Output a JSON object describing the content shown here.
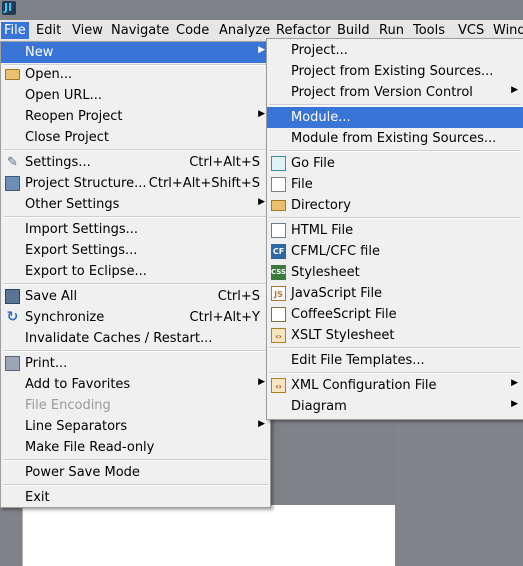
{
  "menubar": {
    "items": [
      "File",
      "Edit",
      "View",
      "Navigate",
      "Code",
      "Analyze",
      "Refactor",
      "Build",
      "Run",
      "Tools",
      "VCS",
      "Wind"
    ],
    "active": "File"
  },
  "file_menu": {
    "new": "New",
    "open": "Open...",
    "open_url": "Open URL...",
    "reopen_project": "Reopen Project",
    "close_project": "Close Project",
    "settings": "Settings...",
    "settings_shortcut": "Ctrl+Alt+S",
    "project_structure": "Project Structure...",
    "project_structure_shortcut": "Ctrl+Alt+Shift+S",
    "other_settings": "Other Settings",
    "import_settings": "Import Settings...",
    "export_settings": "Export Settings...",
    "export_to_eclipse": "Export to Eclipse...",
    "save_all": "Save All",
    "save_all_shortcut": "Ctrl+S",
    "synchronize": "Synchronize",
    "synchronize_shortcut": "Ctrl+Alt+Y",
    "invalidate_caches": "Invalidate Caches / Restart...",
    "print": "Print...",
    "add_to_favorites": "Add to Favorites",
    "file_encoding": "File Encoding",
    "line_separators": "Line Separators",
    "make_read_only": "Make File Read-only",
    "power_save_mode": "Power Save Mode",
    "exit": "Exit"
  },
  "new_submenu": {
    "project": "Project...",
    "project_from_existing": "Project from Existing Sources...",
    "project_from_vcs": "Project from Version Control",
    "module": "Module...",
    "module_from_existing": "Module from Existing Sources...",
    "go_file": "Go File",
    "file": "File",
    "directory": "Directory",
    "html_file": "HTML File",
    "cfml_cfc_file": "CFML/CFC file",
    "stylesheet": "Stylesheet",
    "javascript_file": "JavaScript File",
    "coffeescript_file": "CoffeeScript File",
    "xslt_stylesheet": "XSLT Stylesheet",
    "edit_file_templates": "Edit File Templates...",
    "xml_configuration_file": "XML Configuration File",
    "diagram": "Diagram"
  },
  "icons": {
    "app": "JI",
    "cf": "CF",
    "css": "CSS",
    "js": "JS"
  },
  "colors": {
    "highlight": "#3875d7",
    "menu_background": "#f0f0f0",
    "disabled_text": "#9a9a9a"
  }
}
